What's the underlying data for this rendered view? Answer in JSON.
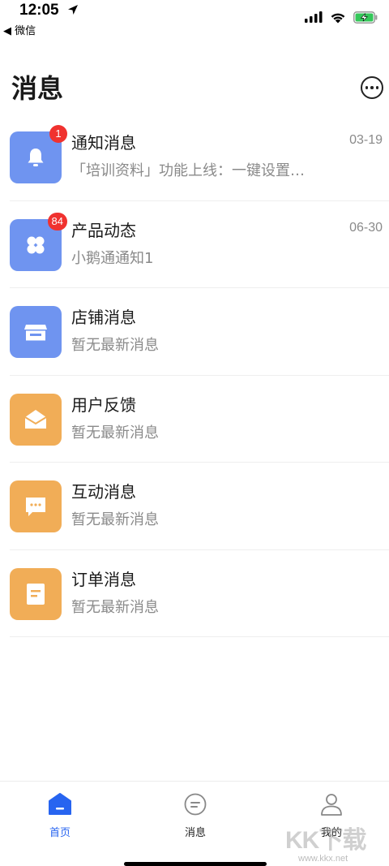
{
  "status_bar": {
    "time": "12:05",
    "back_app": "◀ 微信"
  },
  "header": {
    "title": "消息"
  },
  "messages": [
    {
      "title": "通知消息",
      "subtitle": "「培训资料」功能上线：一键设置…",
      "date": "03-19",
      "badge": "1",
      "icon": "bell-icon",
      "color": "#6f94f0"
    },
    {
      "title": "产品动态",
      "subtitle": "小鹅通通知1",
      "date": "06-30",
      "badge": "84",
      "icon": "product-grid-icon",
      "color": "#6f94f0"
    },
    {
      "title": "店铺消息",
      "subtitle": "暂无最新消息",
      "date": "",
      "badge": "",
      "icon": "store-icon",
      "color": "#6f94f0"
    },
    {
      "title": "用户反馈",
      "subtitle": "暂无最新消息",
      "date": "",
      "badge": "",
      "icon": "envelope-icon",
      "color": "#f1ad57"
    },
    {
      "title": "互动消息",
      "subtitle": "暂无最新消息",
      "date": "",
      "badge": "",
      "icon": "chat-bubble-icon",
      "color": "#f1ad57"
    },
    {
      "title": "订单消息",
      "subtitle": "暂无最新消息",
      "date": "",
      "badge": "",
      "icon": "order-document-icon",
      "color": "#f1ad57"
    }
  ],
  "tab_bar": {
    "home_label": "首页",
    "messages_label": "消息",
    "me_label": "我的",
    "active_color": "#2764f0"
  },
  "watermark": {
    "text": "KK下载",
    "url": "www.kkx.net"
  }
}
